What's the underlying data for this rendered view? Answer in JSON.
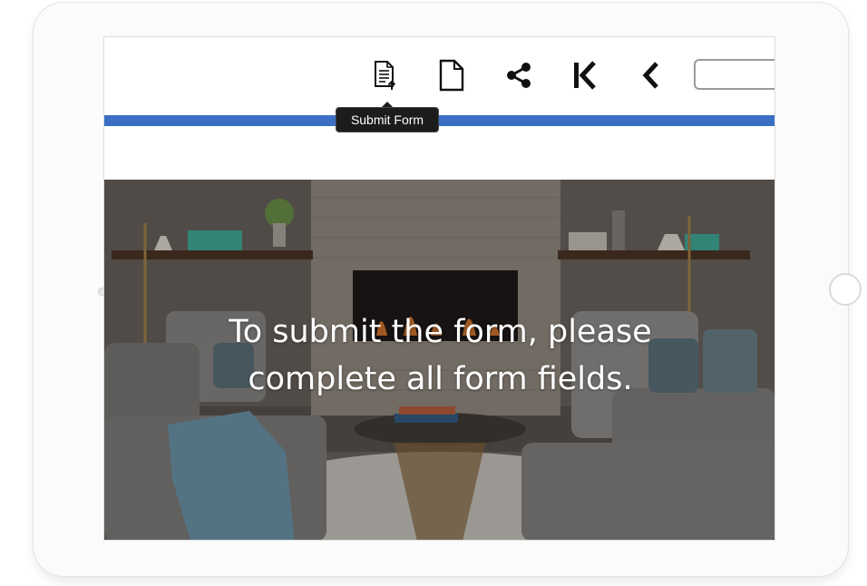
{
  "toolbar": {
    "icons": [
      "submit-form-icon",
      "document-icon",
      "share-icon",
      "first-page-icon",
      "previous-page-icon"
    ],
    "page_input_value": ""
  },
  "tooltip": {
    "text": "Submit Form"
  },
  "progress": {
    "color": "#3b6fc4"
  },
  "hero": {
    "message_line1": "To submit the form, please",
    "message_line2": "complete all form fields."
  }
}
